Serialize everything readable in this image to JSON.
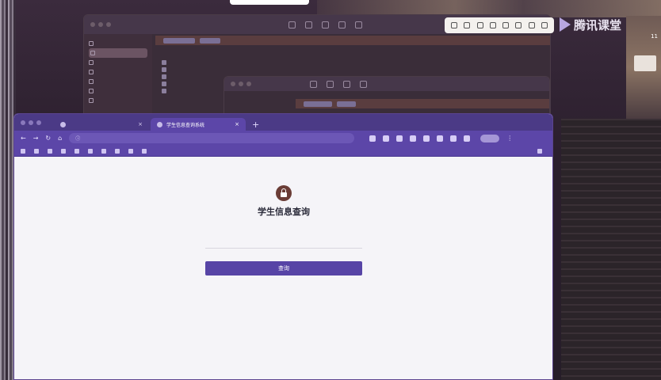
{
  "brand": {
    "name": "腾讯课堂"
  },
  "side_number": "11",
  "finder_main": {
    "sidebar_items": [
      "",
      "",
      "",
      "",
      "",
      "",
      ""
    ],
    "rows": [
      {
        "name": "",
        "date": "",
        "size": "",
        "kind": ""
      },
      {
        "name": "",
        "date": "",
        "size": "",
        "kind": ""
      },
      {
        "name": "",
        "date": "",
        "size": "",
        "kind": ""
      },
      {
        "name": "",
        "date": "",
        "size": "",
        "kind": ""
      },
      {
        "name": "",
        "date": "",
        "size": "",
        "kind": ""
      }
    ]
  },
  "browser": {
    "tabs": [
      {
        "label": ""
      },
      {
        "label": "学生信息查询系统"
      }
    ],
    "url": "",
    "bookmarks": [
      "",
      "",
      "",
      "",
      "",
      "",
      "",
      "",
      "",
      ""
    ],
    "bookmarks_right": ""
  },
  "page": {
    "title": "学生信息查询",
    "input_placeholder": "",
    "query_label": "查询"
  },
  "colors": {
    "accent": "#5744a6",
    "lock_badge": "#6a3c36"
  }
}
